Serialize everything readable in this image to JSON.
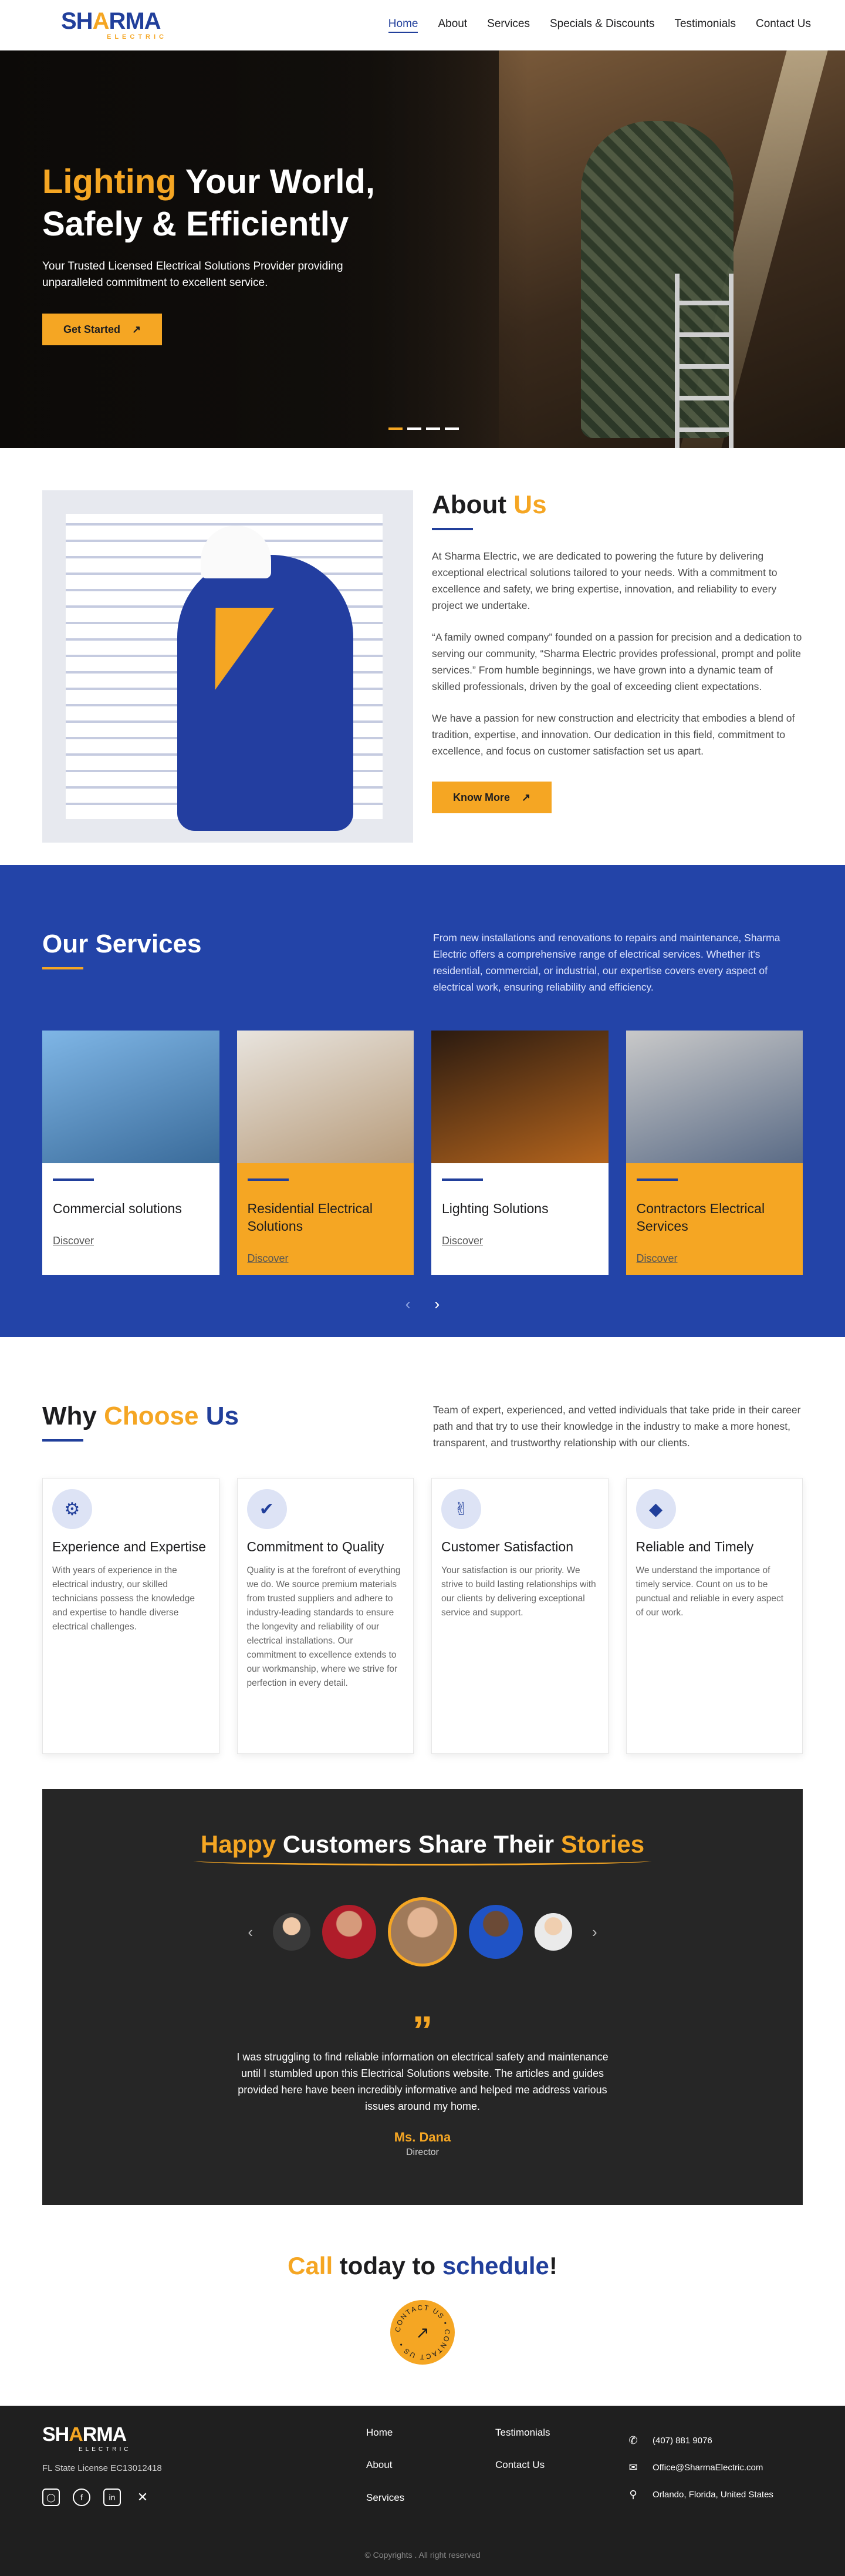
{
  "brand": {
    "name_part1": "SH",
    "name_bolt": "A",
    "name_part2": "RMA",
    "tagline": "ELECTRIC"
  },
  "nav": {
    "items": [
      "Home",
      "About",
      "Services",
      "Specials & Discounts",
      "Testimonials",
      "Contact Us"
    ],
    "active": "Home"
  },
  "hero": {
    "title_accent": "Lighting",
    "title_rest_1": " Your World,",
    "title_line_2": "Safely & Efficiently",
    "subtitle": "Your Trusted Licensed Electrical Solutions Provider providing unparalleled commitment to excellent service.",
    "cta": "Get Started",
    "slides": 4,
    "active_slide": 1
  },
  "about": {
    "title_1": "About ",
    "title_2": "Us",
    "paragraphs": [
      "At Sharma Electric, we are dedicated to powering the future by delivering exceptional electrical solutions tailored to your needs. With a commitment to excellence and safety, we bring expertise, innovation, and reliability to every project we undertake.",
      "“A family owned company” founded on a passion for precision and a dedication to serving our community, “Sharma Electric provides professional, prompt and polite services.” From humble beginnings, we have grown into a dynamic team of skilled professionals, driven by the goal of exceeding client expectations.",
      "We have a passion for new construction and electricity that embodies a blend of tradition, expertise, and innovation. Our dedication in this field, commitment to excellence, and focus on customer satisfaction set us apart."
    ],
    "cta": "Know More"
  },
  "services": {
    "title_1": "Our ",
    "title_2": "Services",
    "description": "From new installations and renovations to repairs and maintenance, Sharma Electric offers a comprehensive range of electrical services. Whether it's residential, commercial, or industrial, our expertise covers every aspect of electrical work, ensuring reliability and efficiency.",
    "cards": [
      {
        "title": "Commercial solutions",
        "link": "Discover",
        "highlight": false,
        "colors": [
          "#7fb6e6",
          "#3a6b9a"
        ]
      },
      {
        "title": "Residential Electrical Solutions",
        "link": "Discover",
        "highlight": true,
        "colors": [
          "#e8e4de",
          "#b79b7a"
        ]
      },
      {
        "title": "Lighting Solutions",
        "link": "Discover",
        "highlight": false,
        "colors": [
          "#2a1a10",
          "#b5651d"
        ]
      },
      {
        "title": "Contractors Electrical Services",
        "link": "Discover",
        "highlight": true,
        "colors": [
          "#c9c9c9",
          "#5a6b86"
        ]
      }
    ],
    "prev_icon": "chevron-left-icon",
    "next_icon": "chevron-right-icon"
  },
  "why": {
    "title_1": "Why ",
    "title_2": "Choose",
    "title_3": " Us",
    "description": "Team of expert, experienced, and vetted individuals that take pride in their career path and that try to use their knowledge in the industry to make a more honest, transparent, and trustworthy relationship with our clients.",
    "cards": [
      {
        "icon": "expert-icon",
        "glyph": "⚙",
        "title": "Experience and Expertise",
        "text": "With years of experience in the electrical industry, our skilled technicians possess the knowledge and expertise to handle diverse electrical challenges."
      },
      {
        "icon": "check-badge-icon",
        "glyph": "✔",
        "title": "Commitment to Quality",
        "text": "Quality is at the forefront of everything we do. We source premium materials from trusted suppliers and adhere to industry-leading standards to ensure the longevity and reliability of our electrical installations. Our commitment to excellence extends to our workmanship, where we strive for perfection in every detail."
      },
      {
        "icon": "thumbs-up-icon",
        "glyph": "✌",
        "title": "Customer Satisfaction",
        "text": "Your satisfaction is our priority. We strive to build lasting relationships with our clients by delivering exceptional service and support."
      },
      {
        "icon": "diamond-hand-icon",
        "glyph": "◆",
        "title": "Reliable and Timely",
        "text": "We understand the importance of timely service. Count on us to be punctual and reliable in every aspect of our work."
      }
    ]
  },
  "testimonials": {
    "title_1": "Happy",
    "title_2": " Customers Share Their ",
    "title_3": "Stories",
    "quote": "I was struggling to find reliable information on electrical safety and maintenance until I stumbled upon this Electrical Solutions website. The articles and guides provided here have been incredibly informative and helped me address various issues around my home.",
    "name": "Ms. Dana",
    "role": "Director",
    "quote_glyph": "„"
  },
  "cta": {
    "title_1": "Call",
    "title_2": " today to ",
    "title_3": "schedule",
    "title_4": "!",
    "badge_text": "CONTACT US • CONTACT US • "
  },
  "footer": {
    "license": "FL State License EC13012418",
    "socials": [
      "instagram-icon",
      "facebook-icon",
      "linkedin-icon",
      "x-icon"
    ],
    "links": [
      "Home",
      "Testimonials",
      "About",
      "Contact Us",
      "Services"
    ],
    "phone": "(407) 881 9076",
    "email": "Office@SharmaElectric.com",
    "address": "Orlando, Florida, United States",
    "copyright": "© Copyrights . All right reserved"
  }
}
